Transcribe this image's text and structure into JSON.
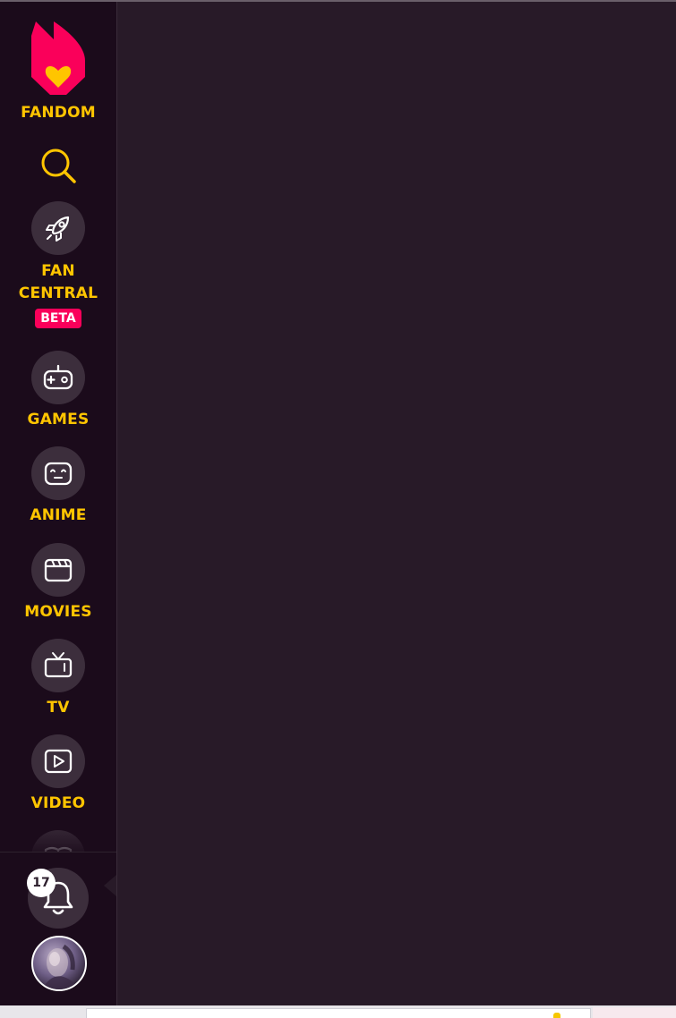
{
  "sidebar": {
    "brand_label": "FANDOM",
    "search_icon": "search-icon",
    "items": [
      {
        "key": "fan-central",
        "label_line1": "FAN",
        "label_line2": "CENTRAL",
        "badge": "BETA",
        "icon": "rocket-icon"
      },
      {
        "key": "games",
        "label": "GAMES",
        "icon": "gamepad-icon"
      },
      {
        "key": "anime",
        "label": "ANIME",
        "icon": "anime-face-icon"
      },
      {
        "key": "movies",
        "label": "MOVIES",
        "icon": "clapperboard-icon"
      },
      {
        "key": "tv",
        "label": "TV",
        "icon": "tv-icon"
      },
      {
        "key": "video",
        "label": "VIDEO",
        "icon": "play-icon"
      },
      {
        "key": "more",
        "icon": "book-icon"
      }
    ],
    "notifications": {
      "count": "17",
      "icon": "bell-icon"
    },
    "avatar": "user-avatar"
  },
  "colors": {
    "sidebar_bg": "#1b0b1b",
    "main_bg": "#281a28",
    "accent_yellow": "#ffc500",
    "brand_pink": "#fa005a",
    "icon_circle": "#3c2e3c"
  }
}
